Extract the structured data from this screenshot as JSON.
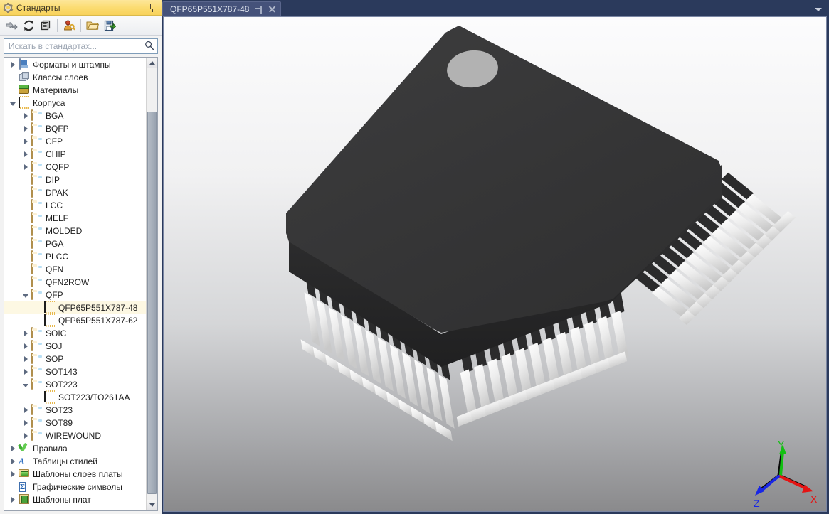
{
  "panel": {
    "title": "Стандарты",
    "pin_tooltip": "Закрепить",
    "toolbar": [
      {
        "name": "go-to-icon",
        "label": "Перейти"
      },
      {
        "name": "refresh-icon",
        "label": "Обновить"
      },
      {
        "name": "duplicate-icon",
        "label": "Копировать"
      },
      {
        "name": "user-permissions-icon",
        "label": "Права доступа"
      },
      {
        "name": "open-folder-icon",
        "label": "Открыть"
      },
      {
        "name": "save-export-icon",
        "label": "Сохранить"
      }
    ],
    "search": {
      "value": "",
      "placeholder": "Искать в стандартах...",
      "icon": "search-icon"
    },
    "tree": [
      {
        "label": "Форматы и штампы",
        "icon": "document-icon",
        "indent": 0,
        "state": "collapsed"
      },
      {
        "label": "Классы слоев",
        "icon": "layers-icon",
        "indent": 0,
        "state": "leaf"
      },
      {
        "label": "Материалы",
        "icon": "materials-icon",
        "indent": 0,
        "state": "leaf"
      },
      {
        "label": "Корпуса",
        "icon": "chip-icon",
        "indent": 0,
        "state": "expanded"
      },
      {
        "label": "BGA",
        "icon": "folder-icon",
        "indent": 1,
        "state": "collapsed"
      },
      {
        "label": "BQFP",
        "icon": "folder-icon",
        "indent": 1,
        "state": "collapsed"
      },
      {
        "label": "CFP",
        "icon": "folder-icon",
        "indent": 1,
        "state": "collapsed"
      },
      {
        "label": "CHIP",
        "icon": "folder-icon",
        "indent": 1,
        "state": "collapsed"
      },
      {
        "label": "CQFP",
        "icon": "folder-icon",
        "indent": 1,
        "state": "collapsed"
      },
      {
        "label": "DIP",
        "icon": "folder-icon",
        "indent": 1,
        "state": "leaf"
      },
      {
        "label": "DPAK",
        "icon": "folder-icon",
        "indent": 1,
        "state": "leaf"
      },
      {
        "label": "LCC",
        "icon": "folder-icon",
        "indent": 1,
        "state": "leaf"
      },
      {
        "label": "MELF",
        "icon": "folder-icon",
        "indent": 1,
        "state": "leaf"
      },
      {
        "label": "MOLDED",
        "icon": "folder-icon",
        "indent": 1,
        "state": "leaf"
      },
      {
        "label": "PGA",
        "icon": "folder-icon",
        "indent": 1,
        "state": "leaf"
      },
      {
        "label": "PLCC",
        "icon": "folder-icon",
        "indent": 1,
        "state": "leaf"
      },
      {
        "label": "QFN",
        "icon": "folder-icon",
        "indent": 1,
        "state": "leaf"
      },
      {
        "label": "QFN2ROW",
        "icon": "folder-icon",
        "indent": 1,
        "state": "leaf"
      },
      {
        "label": "QFP",
        "icon": "folder-icon",
        "indent": 1,
        "state": "expanded"
      },
      {
        "label": "QFP65P551X787-48",
        "icon": "chip-icon",
        "indent": 2,
        "state": "leaf",
        "selected": true
      },
      {
        "label": "QFP65P551X787-62",
        "icon": "chip-icon",
        "indent": 2,
        "state": "leaf"
      },
      {
        "label": "SOIC",
        "icon": "folder-icon",
        "indent": 1,
        "state": "collapsed"
      },
      {
        "label": "SOJ",
        "icon": "folder-icon",
        "indent": 1,
        "state": "collapsed"
      },
      {
        "label": "SOP",
        "icon": "folder-icon",
        "indent": 1,
        "state": "collapsed"
      },
      {
        "label": "SOT143",
        "icon": "folder-icon",
        "indent": 1,
        "state": "collapsed"
      },
      {
        "label": "SOT223",
        "icon": "folder-icon",
        "indent": 1,
        "state": "expanded"
      },
      {
        "label": "SOT223/TO261AA",
        "icon": "chip-icon",
        "indent": 2,
        "state": "leaf"
      },
      {
        "label": "SOT23",
        "icon": "folder-icon",
        "indent": 1,
        "state": "collapsed"
      },
      {
        "label": "SOT89",
        "icon": "folder-icon",
        "indent": 1,
        "state": "collapsed"
      },
      {
        "label": "WIREWOUND",
        "icon": "folder-icon",
        "indent": 1,
        "state": "collapsed"
      },
      {
        "label": "Правила",
        "icon": "rules-check-icon",
        "indent": 0,
        "state": "collapsed"
      },
      {
        "label": "Таблицы стилей",
        "icon": "styles-icon",
        "indent": 0,
        "state": "collapsed"
      },
      {
        "label": "Шаблоны слоев платы",
        "icon": "board-layer-templates-icon",
        "indent": 0,
        "state": "collapsed"
      },
      {
        "label": "Графические символы",
        "icon": "graphic-symbols-icon",
        "indent": 0,
        "state": "leaf"
      },
      {
        "label": "Шаблоны плат",
        "icon": "board-templates-icon",
        "indent": 0,
        "state": "collapsed"
      }
    ]
  },
  "tabs": {
    "items": [
      {
        "label": "QFP65P551X787-48",
        "active": true
      }
    ],
    "pin_icon": "pin-icon",
    "close_icon": "close-icon",
    "menu_icon": "chevron-down-icon"
  },
  "viewport": {
    "model": "QFP65P551X787-48",
    "body_color": "#373738",
    "lead_color": "#efefef",
    "pin1_marker_color": "#b0b0b0",
    "background_top": "#fcfcfd",
    "background_bottom": "#8a8a8c",
    "axes": {
      "x_label": "X",
      "x_color": "#e01010",
      "y_label": "Y",
      "y_color": "#10c010",
      "z_label": "Z",
      "z_color": "#1020e0"
    }
  }
}
